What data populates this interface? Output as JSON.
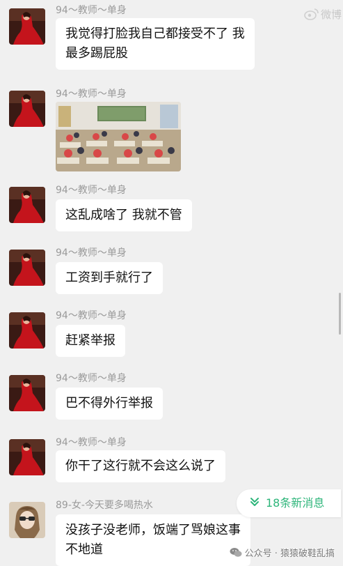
{
  "watermark_top": "微博",
  "messages": [
    {
      "sender": "94～教师～单身",
      "lines": [
        "我觉得打脸我自己都接受不了 我",
        "最多踢屁股"
      ]
    },
    {
      "sender": "94～教师～单身",
      "image": "classroom-photo"
    },
    {
      "sender": "94～教师～单身",
      "lines": [
        "这乱成啥了 我就不管"
      ]
    },
    {
      "sender": "94～教师～单身",
      "lines": [
        "工资到手就行了"
      ]
    },
    {
      "sender": "94～教师～单身",
      "lines": [
        "赶紧举报"
      ]
    },
    {
      "sender": "94～教师～单身",
      "lines": [
        "巴不得外行举报"
      ]
    },
    {
      "sender": "94～教师～单身",
      "lines": [
        "你干了这行就不会这么说了"
      ]
    },
    {
      "sender": "89-女-今天要多喝热水",
      "lines": [
        "没孩子没老师，饭端了骂娘这事",
        "不地道"
      ]
    }
  ],
  "new_messages_label": "18条新消息",
  "bottom_watermark": "公众号 · 猿猿破鞋乱搞",
  "colors": {
    "background": "#f0f0f0",
    "bubble": "#ffffff",
    "sender_text": "#9a9a9a",
    "accent_green": "#2db57a"
  }
}
